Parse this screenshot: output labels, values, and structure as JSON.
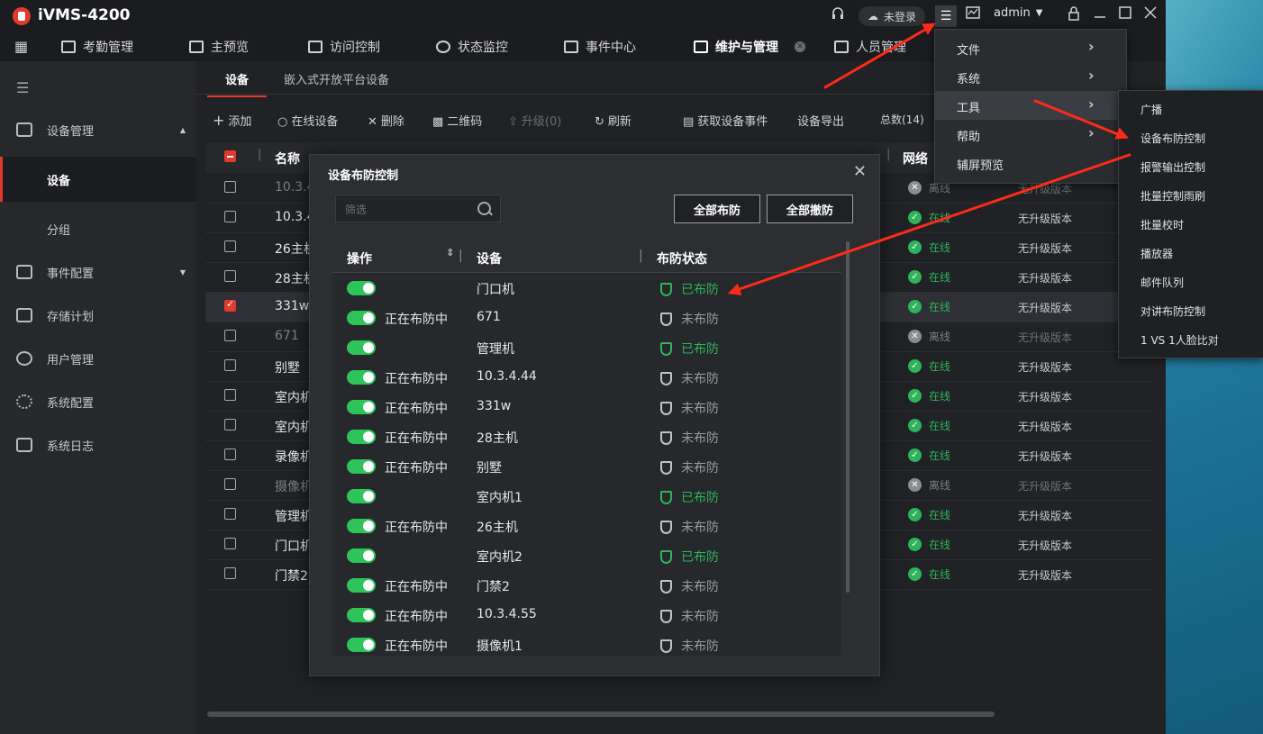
{
  "app": {
    "name": "iVMS-4200"
  },
  "titlebar": {
    "login_status": "未登录",
    "user": "admin"
  },
  "nav_tabs": [
    {
      "label": "考勤管理"
    },
    {
      "label": "主预览"
    },
    {
      "label": "访问控制"
    },
    {
      "label": "状态监控"
    },
    {
      "label": "事件中心"
    },
    {
      "label": "维护与管理",
      "active": true
    },
    {
      "label": "人员管理"
    }
  ],
  "sidebar": {
    "device_mgmt": "设备管理",
    "device": "设备",
    "group": "分组",
    "event_config": "事件配置",
    "storage_plan": "存储计划",
    "user_mgmt": "用户管理",
    "system_config": "系统配置",
    "system_log": "系统日志"
  },
  "subtabs": {
    "device": "设备",
    "embedded": "嵌入式开放平台设备"
  },
  "toolbar": {
    "add": "添加",
    "online_device": "在线设备",
    "delete": "删除",
    "qrcode": "二维码",
    "upgrade": "升级(0)",
    "refresh": "刷新",
    "get_events": "获取设备事件",
    "export": "设备导出",
    "total": "总数(14)"
  },
  "grid": {
    "col_name": "名称",
    "col_network": "网络",
    "rows": [
      {
        "name": "10.3.4",
        "status": "离线",
        "upgrade": "无升级版本",
        "online": false
      },
      {
        "name": "10.3.4",
        "status": "在线",
        "upgrade": "无升级版本",
        "online": true
      },
      {
        "name": "26主机",
        "status": "在线",
        "upgrade": "无升级版本",
        "online": true
      },
      {
        "name": "28主机",
        "status": "在线",
        "upgrade": "无升级版本",
        "online": true
      },
      {
        "name": "331w",
        "status": "在线",
        "upgrade": "无升级版本",
        "online": true,
        "checked": true
      },
      {
        "name": "671",
        "status": "离线",
        "upgrade": "无升级版本",
        "online": false
      },
      {
        "name": "别墅",
        "status": "在线",
        "upgrade": "无升级版本",
        "online": true
      },
      {
        "name": "室内机",
        "status": "在线",
        "upgrade": "无升级版本",
        "online": true
      },
      {
        "name": "室内机",
        "status": "在线",
        "upgrade": "无升级版本",
        "online": true
      },
      {
        "name": "录像机",
        "status": "在线",
        "upgrade": "无升级版本",
        "online": true
      },
      {
        "name": "摄像机",
        "status": "离线",
        "upgrade": "无升级版本",
        "online": false
      },
      {
        "name": "管理机",
        "status": "在线",
        "upgrade": "无升级版本",
        "online": true
      },
      {
        "name": "门口机",
        "status": "在线",
        "upgrade": "无升级版本",
        "online": true
      },
      {
        "name": "门禁2",
        "status": "在线",
        "upgrade": "无升级版本",
        "online": true
      }
    ]
  },
  "modal": {
    "title": "设备布防控制",
    "filter_placeholder": "筛选",
    "arm_all": "全部布防",
    "disarm_all": "全部撤防",
    "col_op": "操作",
    "col_device": "设备",
    "col_status": "布防状态",
    "rows": [
      {
        "busy": "",
        "device": "门口机",
        "status": "已布防",
        "armed": true
      },
      {
        "busy": "正在布防中",
        "device": "671",
        "status": "未布防",
        "armed": false
      },
      {
        "busy": "",
        "device": "管理机",
        "status": "已布防",
        "armed": true
      },
      {
        "busy": "正在布防中",
        "device": "10.3.4.44",
        "status": "未布防",
        "armed": false
      },
      {
        "busy": "正在布防中",
        "device": "331w",
        "status": "未布防",
        "armed": false
      },
      {
        "busy": "正在布防中",
        "device": "28主机",
        "status": "未布防",
        "armed": false
      },
      {
        "busy": "正在布防中",
        "device": "别墅",
        "status": "未布防",
        "armed": false
      },
      {
        "busy": "",
        "device": "室内机1",
        "status": "已布防",
        "armed": true
      },
      {
        "busy": "正在布防中",
        "device": "26主机",
        "status": "未布防",
        "armed": false
      },
      {
        "busy": "",
        "device": "室内机2",
        "status": "已布防",
        "armed": true
      },
      {
        "busy": "正在布防中",
        "device": "门禁2",
        "status": "未布防",
        "armed": false
      },
      {
        "busy": "正在布防中",
        "device": "10.3.4.55",
        "status": "未布防",
        "armed": false
      },
      {
        "busy": "正在布防中",
        "device": "摄像机1",
        "status": "未布防",
        "armed": false
      }
    ]
  },
  "menu": {
    "items": [
      {
        "label": "文件",
        "arrow": "›"
      },
      {
        "label": "系统",
        "arrow": "›"
      },
      {
        "label": "工具",
        "arrow": "›"
      },
      {
        "label": "帮助",
        "arrow": "›"
      },
      {
        "label": "辅屏预览",
        "arrow": ""
      }
    ]
  },
  "submenu": {
    "items": [
      "广播",
      "设备布防控制",
      "报警输出控制",
      "批量控制雨刷",
      "批量校时",
      "播放器",
      "邮件队列",
      "对讲布防控制",
      "1 VS 1人脸比对"
    ]
  },
  "colors": {
    "accent": "#e23a2e",
    "online": "#2fb35a",
    "annotation": "#ff2a1a"
  },
  "icons": [
    "app-logo-icon",
    "search-icon",
    "close-icon",
    "shield-icon",
    "toggle-icon",
    "chevron-right-icon"
  ]
}
